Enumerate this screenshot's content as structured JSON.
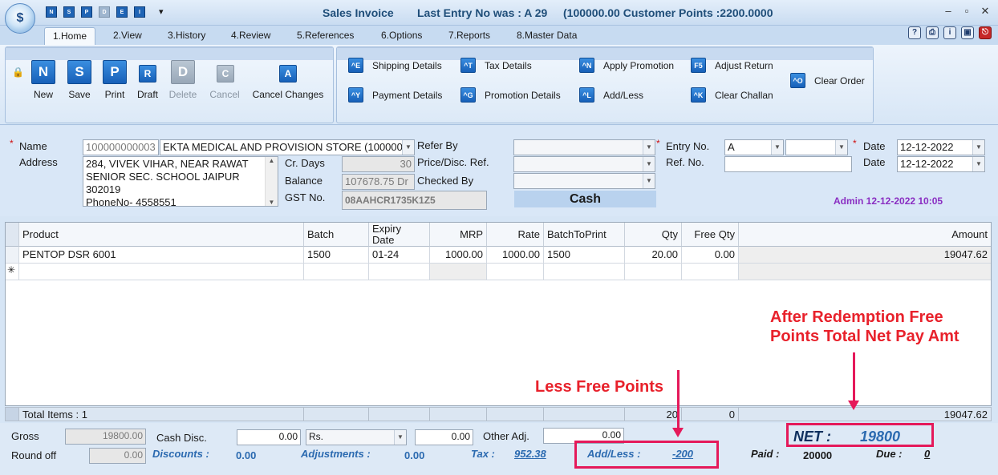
{
  "titlebar": {
    "app_logo": "$",
    "title": "Sales Invoice",
    "last_entry": "Last Entry No was : A 29",
    "customer_points": "(100000.00  Customer Points :2200.0000",
    "quick_access": [
      "N",
      "S",
      "P",
      "D",
      "E",
      "I"
    ],
    "qat_dropdown": "▾",
    "minimize": "–",
    "restore": "▫",
    "close": "✕"
  },
  "tabs": [
    "1.Home",
    "2.View",
    "3.History",
    "4.Review",
    "5.References",
    "6.Options",
    "7.Reports",
    "8.Master Data"
  ],
  "header_icons": [
    "?",
    "⎙",
    "i",
    "▣",
    "⎋"
  ],
  "ribbon": {
    "main_buttons": [
      {
        "icon": "N",
        "label": "New"
      },
      {
        "icon": "S",
        "label": "Save"
      },
      {
        "icon": "P",
        "label": "Print"
      },
      {
        "icon": "R",
        "label": "Draft"
      },
      {
        "icon": "D",
        "label": "Delete"
      },
      {
        "icon": "C",
        "label": "Cancel"
      },
      {
        "icon": "A",
        "label": "Cancel Changes"
      }
    ],
    "lock_icon": "🔒",
    "detail_buttons": [
      {
        "key": "^E",
        "label": "Shipping Details"
      },
      {
        "key": "^Y",
        "label": "Payment Details"
      },
      {
        "key": "^T",
        "label": "Tax Details"
      },
      {
        "key": "^G",
        "label": "Promotion Details"
      },
      {
        "key": "^N",
        "label": "Apply Promotion"
      },
      {
        "key": "^L",
        "label": "Add/Less"
      },
      {
        "key": "F5",
        "label": "Adjust Return"
      },
      {
        "key": "^K",
        "label": "Clear Challan"
      },
      {
        "key": "^O",
        "label": "Clear Order"
      }
    ]
  },
  "form": {
    "name_label": "Name",
    "name_code": "100000000003",
    "name_value": "EKTA MEDICAL AND PROVISION STORE (100000",
    "address_label": "Address",
    "address_lines": [
      "284, VIVEK VIHAR, NEAR RAWAT",
      "SENIOR  SEC. SCHOOL JAIPUR",
      "302019",
      "PhoneNo- 4558551"
    ],
    "cr_days_label": "Cr. Days",
    "cr_days": "30",
    "balance_label": "Balance",
    "balance": "107678.75 Dr",
    "gst_label": "GST No.",
    "gst": "08AAHCR1735K1Z5",
    "refer_by_label": "Refer By",
    "price_disc_label": "Price/Disc. Ref.",
    "checked_by_label": "Checked By",
    "payment_mode": "Cash",
    "entry_no_label": "Entry No.",
    "entry_series": "A",
    "entry_number": "",
    "ref_no_label": "Ref. No.",
    "ref_no": "",
    "date_label": "Date",
    "date1": "12-12-2022",
    "date2_label": "Date",
    "date2": "12-12-2022",
    "admin_stamp": "Admin 12-12-2022 10:05",
    "required_mark": "*"
  },
  "grid": {
    "columns": [
      "Product",
      "Batch",
      "Expiry Date",
      "MRP",
      "Rate",
      "BatchToPrint",
      "Qty",
      "Free Qty",
      "Amount"
    ],
    "rows": [
      [
        "PENTOP DSR 6001",
        "1500",
        "01-24",
        "1000.00",
        "1000.00",
        "1500",
        "20.00",
        "0.00",
        "19047.62"
      ]
    ],
    "new_row_marker": "✳",
    "totals_label": "Total Items : 1",
    "total_qty": "20",
    "total_free": "0",
    "total_amount": "19047.62"
  },
  "footer": {
    "gross_label": "Gross",
    "gross": "19800.00",
    "roundoff_label": "Round off",
    "roundoff": "0.00",
    "cash_disc_label": "Cash Disc.",
    "cash_disc": "0.00",
    "disc_type": "Rs.",
    "cash_disc2": "0.00",
    "other_adj_label": "Other Adj.",
    "other_adj": "0.00",
    "discounts_label": "Discounts :",
    "discounts": "0.00",
    "adjustments_label": "Adjustments :",
    "adjustments": "0.00",
    "tax_label": "Tax :",
    "tax": "952.38",
    "addless_label": "Add/Less :",
    "addless": "-200",
    "net_label": "NET :",
    "net": "19800",
    "paid_label": "Paid :",
    "paid": "20000",
    "due_label": "Due :",
    "due": "0"
  },
  "annotations": {
    "free_points": "Less Free Points",
    "net_note_line1": "After Redemption Free",
    "net_note_line2": "Points Total Net Pay Amt",
    "color": "#e5195a"
  }
}
